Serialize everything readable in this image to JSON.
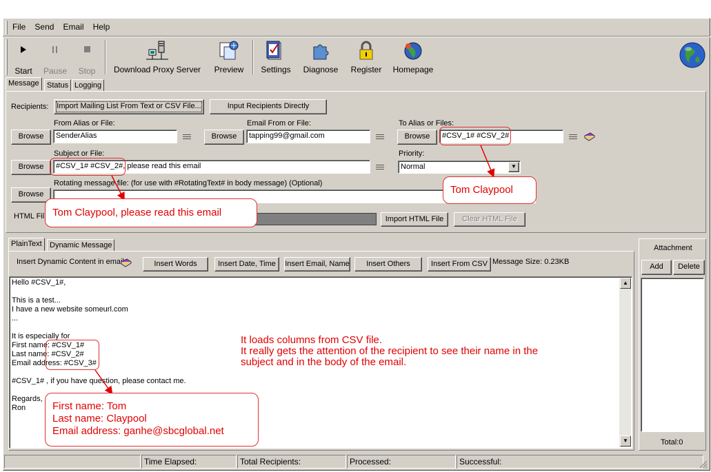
{
  "menu": [
    "File",
    "Send",
    "Email",
    "Help"
  ],
  "toolbar": {
    "start": "Start",
    "pause": "Pause",
    "stop": "Stop",
    "download_proxy": "Download Proxy Server",
    "preview": "Preview",
    "settings": "Settings",
    "diagnose": "Diagnose",
    "register": "Register",
    "homepage": "Homepage"
  },
  "tabs": {
    "message": "Message",
    "status": "Status",
    "logging": "Logging"
  },
  "form": {
    "recipients_label": "Recipients:",
    "import_btn": "Import Mailing List From Text or CSV File...",
    "input_direct_btn": "Input Recipients Directly",
    "browse": "Browse",
    "from_label": "From Alias or File:",
    "from_value": "SenderAlias",
    "email_from_label": "Email From or File:",
    "email_from_value": "tapping99@gmail.com",
    "to_label": "To Alias or Files:",
    "to_value": "#CSV_1# #CSV_2#",
    "subject_label": "Subject or File:",
    "subject_value": "#CSV_1# #CSV_2#, please read this email",
    "priority_label": "Priority:",
    "priority_value": "Normal",
    "rotating_label": "Rotating message file: (for use with #RotatingText# in body message) (Optional)",
    "html_label": "HTML Fil",
    "import_html": "Import HTML File",
    "clear_html": "Clear HTML File"
  },
  "body_tabs": {
    "plain": "PlainText",
    "dynamic": "Dynamic Message"
  },
  "insert": {
    "label": "Insert Dynamic Content in email:",
    "words": "Insert Words",
    "date": "Insert Date, Time",
    "email_name": "Insert Email, Name",
    "others": "Insert Others",
    "csv": "Insert From CSV",
    "size": "Message Size: 0.23KB"
  },
  "message_lines": [
    "Hello #CSV_1#,",
    "",
    "This is a test...",
    "I have a new website someurl.com",
    "...",
    "",
    "It is especially for",
    "First name: #CSV_1#",
    "Last name: #CSV_2#",
    "Email address: #CSV_3#",
    "",
    "#CSV_1# , if you have question, please contact me.",
    "",
    "Regards,",
    "Ron"
  ],
  "attachment": {
    "title": "Attachment",
    "add": "Add",
    "delete": "Delete",
    "total": "Total:0"
  },
  "status": {
    "time": "Time Elapsed:",
    "total": "Total Recipients:",
    "processed": "Processed:",
    "successful": "Successful:"
  },
  "annotations": {
    "to_callout": "Tom Claypool",
    "subject_callout": "Tom Claypool, please read this email",
    "body_callout_1": "First name: Tom",
    "body_callout_2": "Last name: Claypool",
    "body_callout_3": "Email address: ganhe@sbcglobal.net",
    "note_1": "It loads columns from CSV file.",
    "note_2": "It really gets the attention of the recipient to see their name in the",
    "note_3": "subject and in the body of the email."
  }
}
